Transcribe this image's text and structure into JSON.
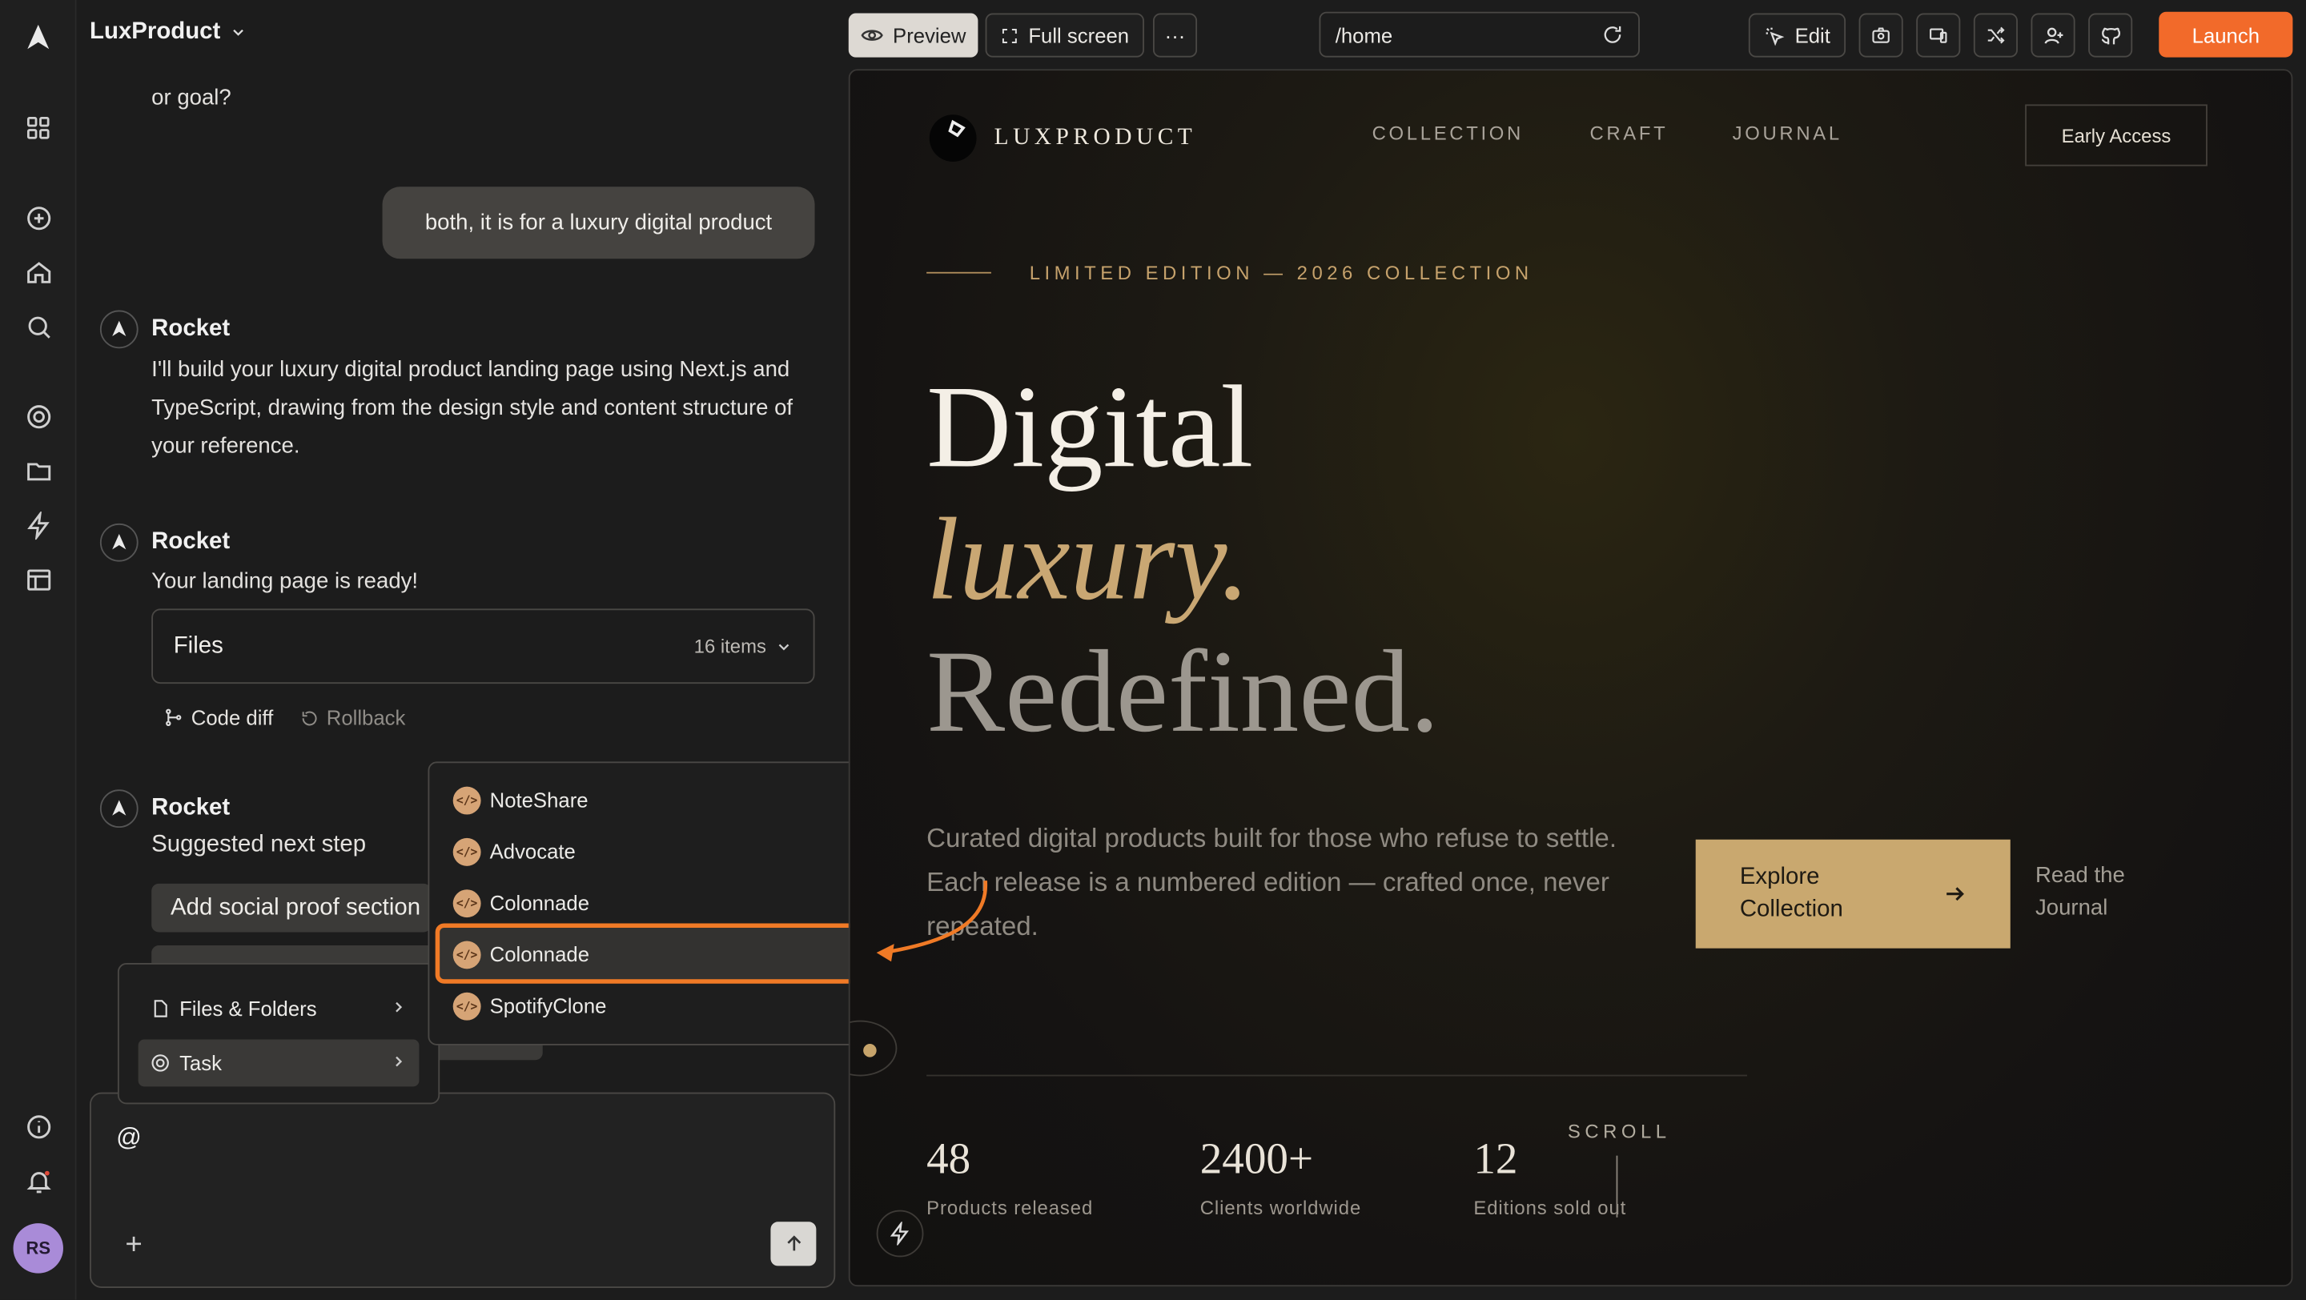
{
  "app": {
    "brand": "LuxProduct"
  },
  "rail": {
    "icons": [
      "rocket-logo-icon",
      "grid-icon",
      "plus-circle-icon",
      "home-icon",
      "search-icon",
      "target-icon",
      "folder-icon",
      "bolt-icon",
      "layout-icon",
      "info-icon",
      "bell-icon"
    ],
    "avatar": "RS"
  },
  "chat": {
    "prev_text": "or goal?",
    "user_message": "both, it is for a luxury digital product",
    "rocket_name": "Rocket",
    "msg1": "I'll build your luxury digital product landing page using Next.js and TypeScript, drawing from the design style and content structure of your reference.",
    "msg2": "Your landing page is ready!",
    "files_label": "Files",
    "files_count": "16 items",
    "code_diff": "Code diff",
    "rollback": "Rollback",
    "msg3": "Suggested next step",
    "suggestion": "Add social proof section"
  },
  "composer": {
    "value": "@"
  },
  "context_menu": {
    "items": [
      {
        "label": "Files & Folders"
      },
      {
        "label": "Task"
      }
    ]
  },
  "submenu": {
    "items": [
      {
        "label": "NoteShare"
      },
      {
        "label": "Advocate"
      },
      {
        "label": "Colonnade"
      },
      {
        "label": "Colonnade"
      },
      {
        "label": "SpotifyClone"
      }
    ]
  },
  "toolbar": {
    "preview": "Preview",
    "fullscreen": "Full screen",
    "more": "···",
    "url": "/home",
    "edit": "Edit",
    "launch": "Launch"
  },
  "preview": {
    "logo": "LUXPRODUCT",
    "nav": [
      "COLLECTION",
      "CRAFT",
      "JOURNAL"
    ],
    "early": "Early Access",
    "eyebrow": "LIMITED EDITION — 2026 COLLECTION",
    "h1a": "Digital",
    "h1b": "luxury.",
    "h1c": "Redefined.",
    "lead": "Curated digital products built for those who refuse to settle. Each release is a numbered edition — crafted once, never repeated.",
    "cta1": "Explore Collection",
    "cta2": "Read the Journal",
    "stats": [
      {
        "n": "48",
        "l": "Products released"
      },
      {
        "n": "2400+",
        "l": "Clients worldwide"
      },
      {
        "n": "12",
        "l": "Editions sold out"
      }
    ],
    "scroll": "SCROLL"
  },
  "colors": {
    "accent": "#f26a2a",
    "gold": "#c9a86f"
  }
}
